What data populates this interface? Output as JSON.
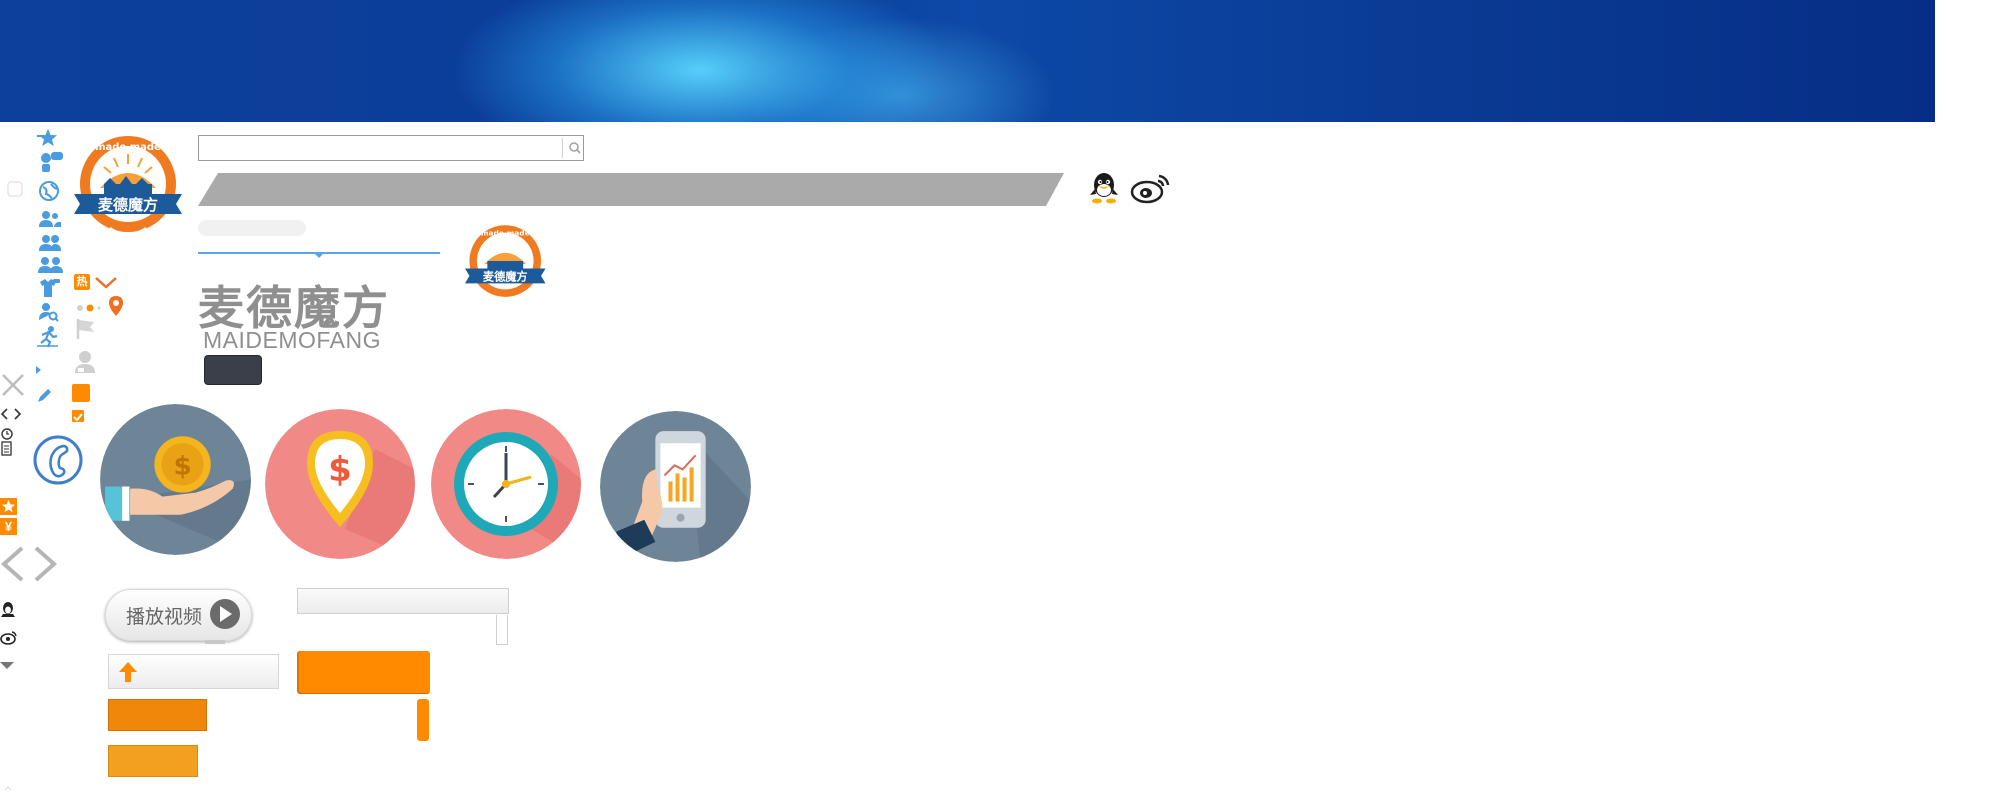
{
  "header": {
    "banner_alt": ""
  },
  "search": {
    "value": "",
    "placeholder": "",
    "icon": "search-icon"
  },
  "nav": {
    "social_icons": [
      "qq-icon",
      "weibo-icon"
    ]
  },
  "brand": {
    "logo_top_text": "made  made",
    "logo_name": "麦德魔方",
    "name_cn": "麦德魔方",
    "name_en": "MAIDEMOFANG"
  },
  "sprites": {
    "hot_label": "热",
    "yen_label": "¥",
    "sidebar_icons": [
      "star-icon",
      "users-tag-icon",
      "globe-icon",
      "users-icon",
      "users-icon",
      "users-icon",
      "shirt-icon",
      "search-user-icon",
      "runner-icon",
      "bullet-icon",
      "pencil-icon",
      "flag-icon",
      "person-icon",
      "location-icon",
      "chevron-down-icon"
    ]
  },
  "features": {
    "circles": [
      {
        "icon": "coin-hand-icon",
        "bg": "#6e8597"
      },
      {
        "icon": "location-dollar-icon",
        "bg": "#f18a86"
      },
      {
        "icon": "clock-icon",
        "bg": "#f18a86"
      },
      {
        "icon": "phone-chart-icon",
        "bg": "#6e8597"
      }
    ]
  },
  "video": {
    "play_label": "播放视频"
  },
  "colors": {
    "accent_orange": "#ff8a00",
    "accent_blue": "#58a7e3",
    "gray_bar": "#aaaaaa",
    "dark_button": "#3b3f4a"
  }
}
